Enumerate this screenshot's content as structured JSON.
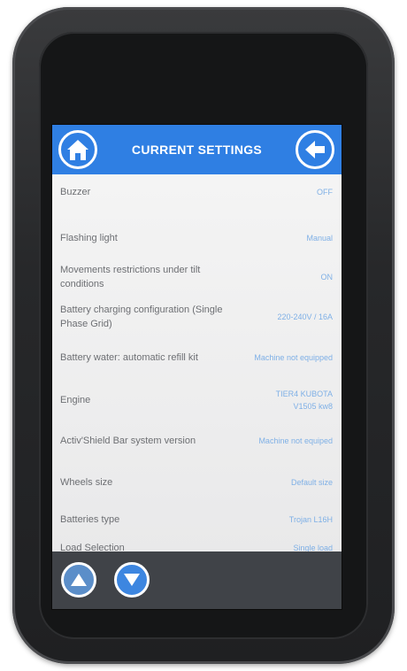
{
  "header": {
    "title": "CURRENT SETTINGS",
    "home_icon": "home-icon",
    "back_icon": "arrow-left-icon"
  },
  "settings": [
    {
      "label": "Buzzer",
      "value": "OFF"
    },
    {
      "label": "Flashing light",
      "value": "Manual"
    },
    {
      "label": "Movements restrictions under tilt conditions",
      "value": "ON"
    },
    {
      "label": "Battery charging configuration (Single Phase Grid)",
      "value": "220-240V / 16A"
    },
    {
      "label": "Battery water: automatic refill kit",
      "value": "Machine not equipped"
    },
    {
      "label": "Engine",
      "value": "TIER4 KUBOTA V1505 kw8"
    },
    {
      "label": "Activ'Shield Bar system version",
      "value": "Machine not equiped"
    },
    {
      "label": "Wheels size",
      "value": "Default size"
    },
    {
      "label": "Batteries type",
      "value": "Trojan L16H"
    },
    {
      "label": "Load Selection",
      "value": "Single load"
    }
  ],
  "footer": {
    "up_icon": "arrow-up-icon",
    "down_icon": "arrow-down-icon"
  },
  "colors": {
    "header": "#2f7fe3",
    "label_text": "#6d6f73",
    "value_text": "#7fb0e6",
    "footer": "#404348"
  }
}
